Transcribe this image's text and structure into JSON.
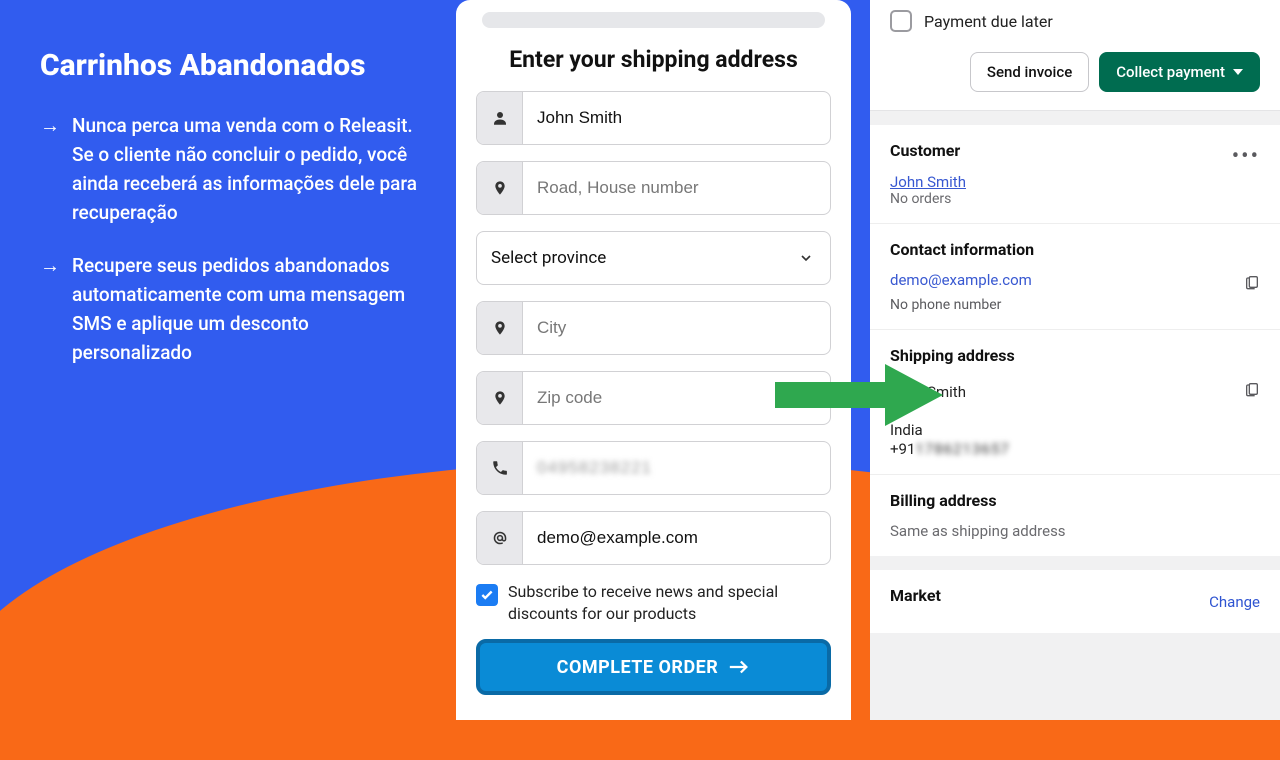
{
  "left": {
    "title": "Carrinhos Abandonados",
    "bullets": [
      "Nunca perca uma venda com o Releasit. Se o cliente não concluir o pedido, você ainda receberá as informações dele para recuperação",
      "Recupere seus pedidos abandonados automaticamente com uma mensagem SMS e aplique um desconto personalizado"
    ]
  },
  "form": {
    "heading": "Enter your shipping address",
    "name_value": "John Smith",
    "address_placeholder": "Road, House number",
    "province_label": "Select province",
    "city_placeholder": "City",
    "zip_placeholder": "Zip code",
    "phone_value": "04958238221",
    "email_value": "demo@example.com",
    "subscribe_text": "Subscribe to receive news and special discounts for our products",
    "cta": "COMPLETE ORDER"
  },
  "right": {
    "payment_due": "Payment due later",
    "send_invoice": "Send invoice",
    "collect_payment": "Collect payment",
    "customer_heading": "Customer",
    "customer_name": "John Smith",
    "customer_orders": "No orders",
    "contact_heading": "Contact information",
    "contact_email": "demo@example.com",
    "no_phone": "No phone number",
    "shipping_heading": "Shipping address",
    "shipping_name": "John Smith",
    "shipping_country": "India",
    "shipping_phone_prefix": "+91",
    "shipping_phone": "1786213657",
    "billing_heading": "Billing address",
    "billing_text": "Same as shipping address",
    "market_heading": "Market",
    "change": "Change"
  }
}
